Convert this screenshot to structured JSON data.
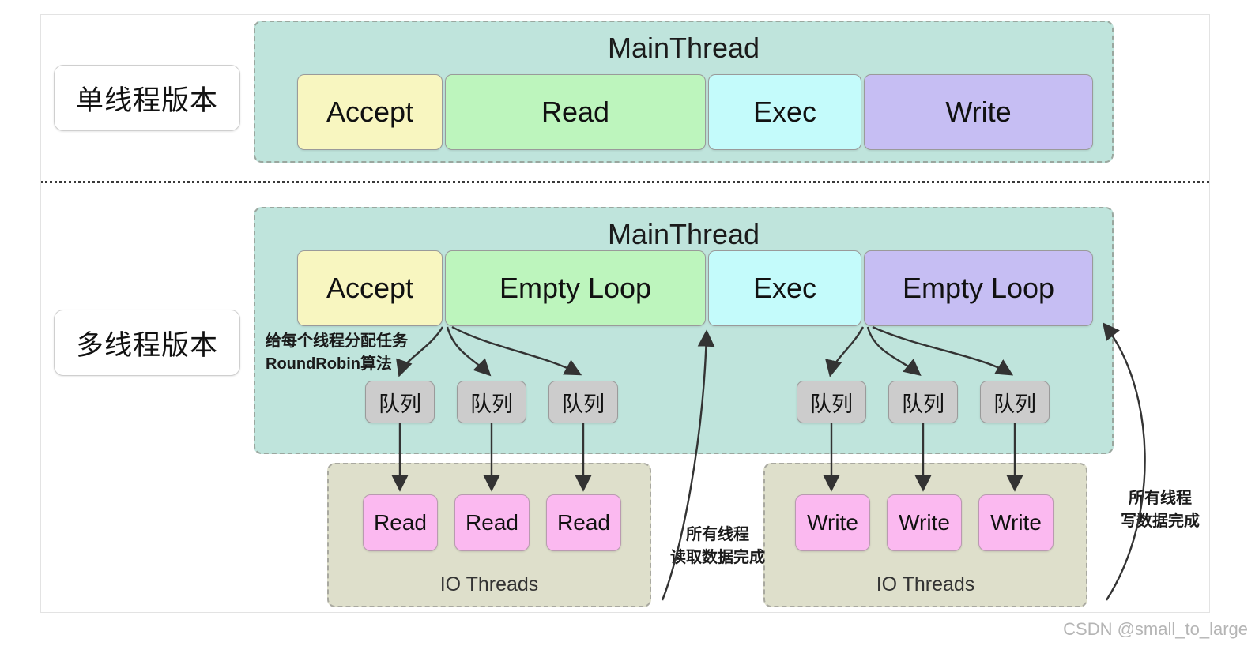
{
  "diagram": {
    "watermark": "CSDN @small_to_large",
    "sections": {
      "single": {
        "label": "单线程版本",
        "mainthread_title": "MainThread",
        "stages": [
          {
            "label": "Accept",
            "color": "#f8f6c0"
          },
          {
            "label": "Read",
            "color": "#bdf5bd"
          },
          {
            "label": "Exec",
            "color": "#c4fbfb"
          },
          {
            "label": "Write",
            "color": "#c6bef3"
          }
        ]
      },
      "multi": {
        "label": "多线程版本",
        "mainthread_title": "MainThread",
        "stages": [
          {
            "label": "Accept",
            "color": "#f8f6c0"
          },
          {
            "label": "Empty Loop",
            "color": "#bdf5bd"
          },
          {
            "label": "Exec",
            "color": "#c4fbfb"
          },
          {
            "label": "Empty Loop",
            "color": "#c6bef3"
          }
        ],
        "queues_left": [
          "队列",
          "队列",
          "队列"
        ],
        "queues_right": [
          "队列",
          "队列",
          "队列"
        ],
        "io_left": {
          "title": "IO Threads",
          "workers": [
            "Read",
            "Read",
            "Read"
          ]
        },
        "io_right": {
          "title": "IO Threads",
          "workers": [
            "Write",
            "Write",
            "Write"
          ]
        },
        "annotations": {
          "round_robin_line1": "给每个线程分配任务",
          "round_robin_line2": "RoundRobin算法",
          "read_done_line1": "所有线程",
          "read_done_line2": "读取数据完成",
          "write_done_line1": "所有线程",
          "write_done_line2": "写数据完成"
        }
      }
    },
    "colors": {
      "mainthread_bg": "#bfe4dc",
      "iothreads_bg": "#dedfcb",
      "queue_bg": "#cccccc",
      "worker_bg": "#fbb9f0",
      "accent_accept": "#f8f6c0",
      "accent_read": "#bdf5bd",
      "accent_exec": "#c4fbfb",
      "accent_write": "#c6bef3"
    }
  }
}
